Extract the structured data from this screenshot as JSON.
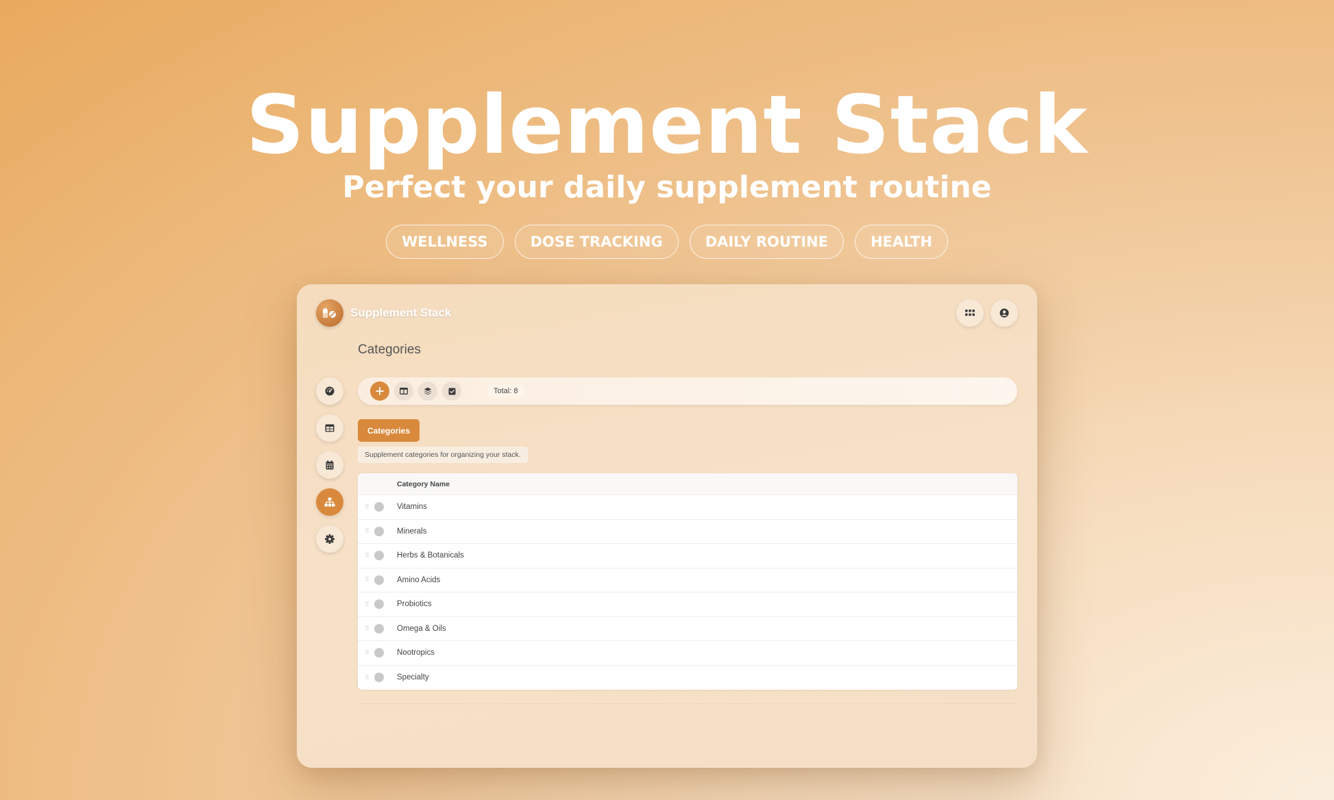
{
  "hero": {
    "title": "Supplement Stack",
    "subtitle": "Perfect your daily supplement routine",
    "tags": [
      "WELLNESS",
      "DOSE TRACKING",
      "DAILY ROUTINE",
      "HEALTH"
    ]
  },
  "app": {
    "name": "Supplement Stack",
    "logo_icon": "pills-icon",
    "top_buttons": [
      "apps-grid-icon",
      "user-account-icon"
    ]
  },
  "page": {
    "title": "Categories"
  },
  "sidebar": {
    "items": [
      {
        "icon": "dashboard-icon",
        "active": false
      },
      {
        "icon": "table-icon",
        "active": false
      },
      {
        "icon": "calendar-icon",
        "active": true
      },
      {
        "icon": "sitemap-icon",
        "active": true
      },
      {
        "icon": "settings-icon",
        "active": false
      }
    ]
  },
  "toolbar": {
    "total_label": "Total:",
    "total_value": "8"
  },
  "section": {
    "label": "Categories",
    "description": "Supplement categories for organizing your stack."
  },
  "table": {
    "header": "Category Name",
    "rows": [
      "Vitamins",
      "Minerals",
      "Herbs & Botanicals",
      "Amino Acids",
      "Probiotics",
      "Omega & Oils",
      "Nootropics",
      "Specialty"
    ]
  },
  "colors": {
    "accent": "#d9893c",
    "background_start": "#e9aa5e",
    "background_end": "#fbeedd"
  }
}
